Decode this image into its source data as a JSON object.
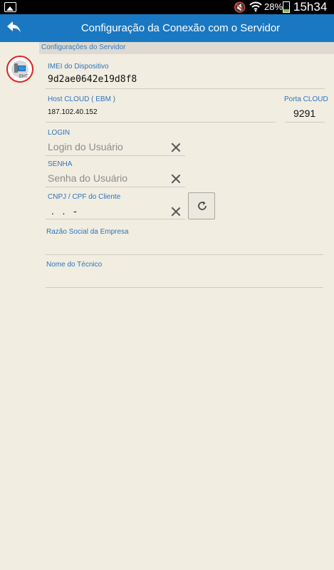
{
  "status_bar": {
    "battery_percent": "28%",
    "battery_level": 0.28,
    "time": "15h34",
    "icons": [
      "gallery-icon",
      "mute-icon",
      "wifi-icon",
      "battery-icon"
    ]
  },
  "action_bar": {
    "title": "Configuração da Conexão com o Servidor",
    "back_icon": "back-arrow-icon",
    "color": "#1a78c2"
  },
  "section": {
    "header": "Configurações do Servidor"
  },
  "fields": {
    "imei": {
      "label": "IMEI do Dispositivo",
      "value": "9d2ae0642e19d8f8"
    },
    "host": {
      "label": "Host CLOUD ( EBM )",
      "value": "187.102.40.152"
    },
    "port": {
      "label": "Porta CLOUD",
      "value": "9291"
    },
    "login": {
      "label": "LOGIN",
      "placeholder": "Login do Usuário"
    },
    "senha": {
      "label": "SENHA",
      "placeholder": "Senha do Usuário"
    },
    "cnpj": {
      "label": "CNPJ / CPF do Cliente",
      "value": ".   .   -"
    },
    "razao": {
      "label": "Razão Social da Empresa",
      "value": ""
    },
    "tecnico": {
      "label": "Nome do Técnico",
      "value": ""
    }
  },
  "colors": {
    "accent": "#1a78c2",
    "label": "#2e74bd",
    "background": "#f1ede1",
    "icon_ring": "#e2201f"
  }
}
